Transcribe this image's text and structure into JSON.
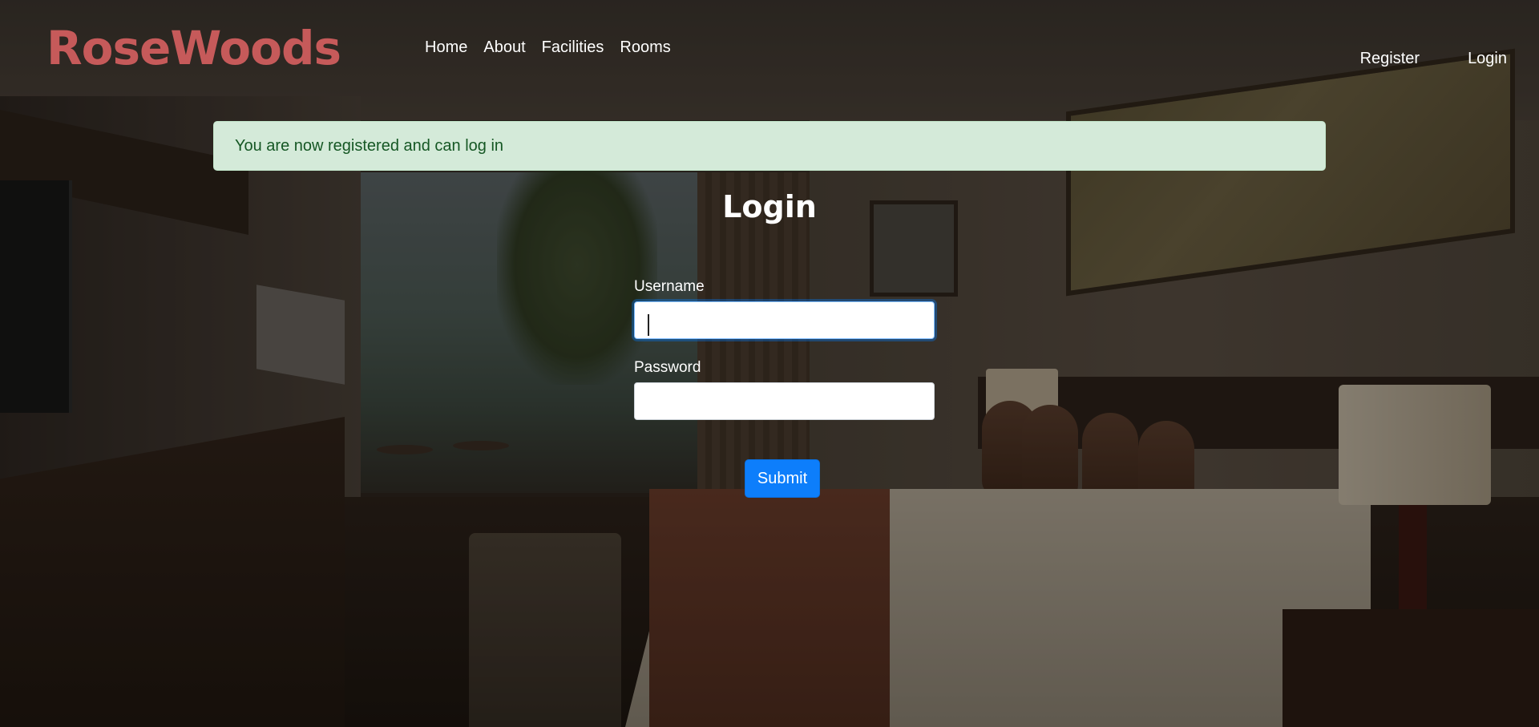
{
  "brand": {
    "name": "RoseWoods",
    "color": "#c65a5a"
  },
  "nav": {
    "left": [
      {
        "label": "Home"
      },
      {
        "label": "About"
      },
      {
        "label": "Facilities"
      },
      {
        "label": "Rooms"
      }
    ],
    "right": [
      {
        "label": "Register"
      },
      {
        "label": "Login"
      }
    ]
  },
  "alert": {
    "message": "You are now registered and can log in",
    "type": "success",
    "background": "#d4ead9",
    "text_color": "#155724"
  },
  "login": {
    "title": "Login",
    "username_label": "Username",
    "username_value": "",
    "username_focused": true,
    "password_label": "Password",
    "password_value": "",
    "submit_label": "Submit",
    "submit_color": "#0d7efb"
  },
  "background_image": "hotel-room-photo"
}
